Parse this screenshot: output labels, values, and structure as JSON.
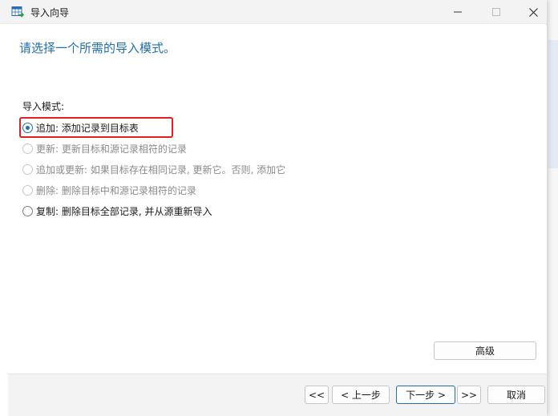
{
  "window": {
    "title": "导入向导",
    "app_icon": "table-import-icon",
    "controls": {
      "minimize_icon": "minimize-icon",
      "maximize_icon": "maximize-icon",
      "close_icon": "close-icon"
    }
  },
  "header": {
    "prompt": "请选择一个所需的导入模式。"
  },
  "import_mode": {
    "label": "导入模式:",
    "options": [
      {
        "label": "追加: 添加记录到目标表",
        "selected": true,
        "enabled": true
      },
      {
        "label": "更新: 更新目标和源记录相符的记录",
        "selected": false,
        "enabled": false
      },
      {
        "label": "追加或更新: 如果目标存在相同记录, 更新它。否则, 添加它",
        "selected": false,
        "enabled": false
      },
      {
        "label": "删除: 删除目标中和源记录相符的记录",
        "selected": false,
        "enabled": false
      },
      {
        "label": "复制: 删除目标全部记录, 并从源重新导入",
        "selected": false,
        "enabled": true
      }
    ],
    "highlight_color": "#e02020"
  },
  "buttons": {
    "advanced": "高级",
    "first": "<<",
    "prev": "< 上一步",
    "next": "下一步 >",
    "last": ">>",
    "cancel": "取消"
  },
  "colors": {
    "accent": "#1f6fb2",
    "titlebar": "#f3f3f3",
    "footer": "#f3f3f3"
  }
}
